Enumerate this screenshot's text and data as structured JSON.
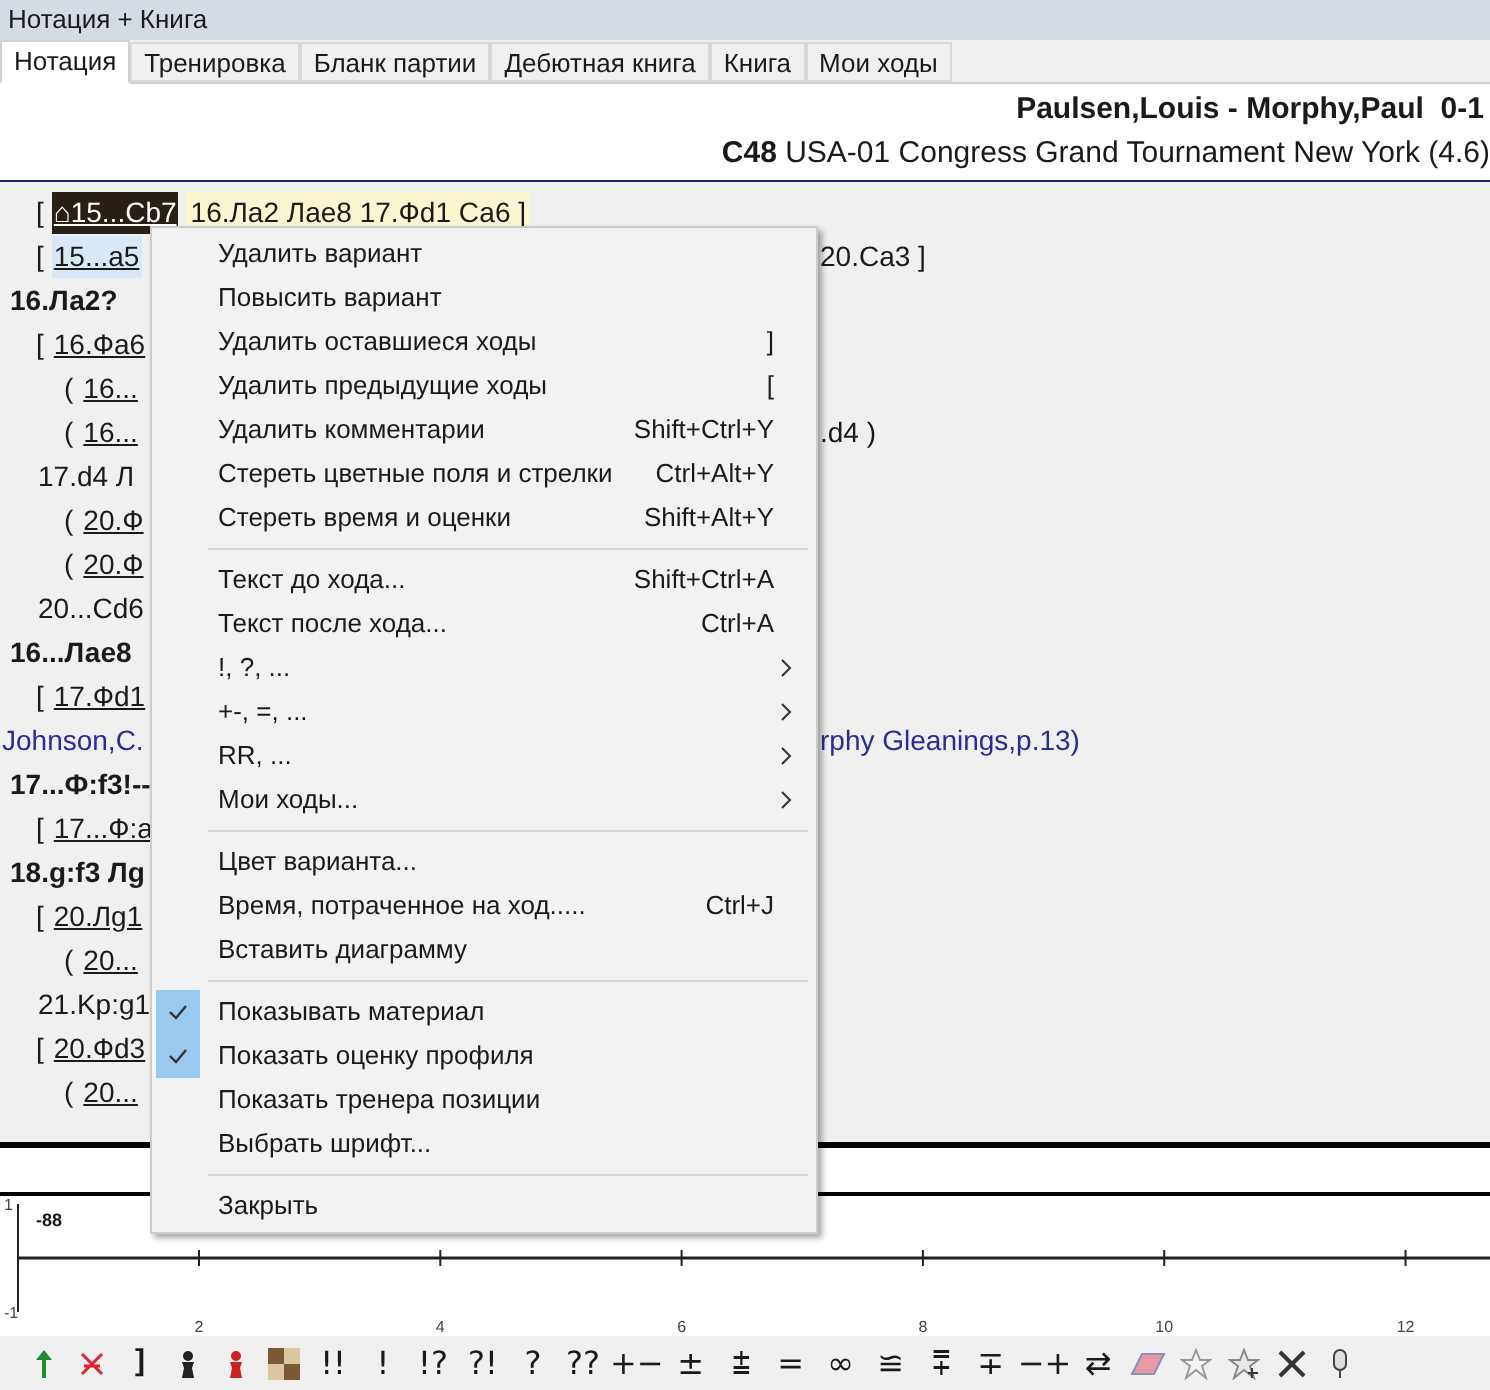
{
  "window": {
    "title": "Нотация + Книга"
  },
  "tabs": [
    {
      "label": "Нотация",
      "selected": true
    },
    {
      "label": "Тренировка",
      "selected": false
    },
    {
      "label": "Бланк партии",
      "selected": false
    },
    {
      "label": "Дебютная книга",
      "selected": false
    },
    {
      "label": "Книга",
      "selected": false
    },
    {
      "label": "Мои ходы",
      "selected": false
    }
  ],
  "game_header": {
    "players": "Paulsen,Louis - Morphy,Paul  0-1",
    "eco": "C48",
    "event": "USA-01 Congress Grand Tournament New York (4.6)"
  },
  "notation": [
    {
      "kind": "variation",
      "prefix": "[",
      "text": "⌂15...Cb7",
      "tail": "16.Ла2 Лае8 17.Фd1 Са6 ]",
      "selected": true,
      "hovered": false
    },
    {
      "kind": "variation",
      "prefix": "[",
      "text": "15...a5",
      "right": "20.Ca3 ]",
      "selected": false,
      "hovered": true
    },
    {
      "kind": "main",
      "text": "16.Ла2?",
      "selected": false,
      "hovered": false
    },
    {
      "kind": "variation",
      "prefix": "[",
      "text": "16.Фа6",
      "selected": false,
      "hovered": false
    },
    {
      "kind": "subvariation",
      "prefix": "(",
      "text": "16...",
      "selected": false,
      "hovered": false
    },
    {
      "kind": "subvariation",
      "prefix": "(",
      "text": "16...",
      "right": ".d4 )",
      "selected": false,
      "hovered": false
    },
    {
      "kind": "continuation",
      "text": "17.d4  Л",
      "selected": false,
      "hovered": false
    },
    {
      "kind": "subvariation",
      "prefix": "(",
      "text": "20.Ф",
      "selected": false,
      "hovered": false
    },
    {
      "kind": "subvariation",
      "prefix": "(",
      "text": "20.Ф",
      "selected": false,
      "hovered": false
    },
    {
      "kind": "continuation",
      "text": "20...Cd6",
      "selected": false,
      "hovered": false
    },
    {
      "kind": "main",
      "text": "16...Лае8",
      "selected": false,
      "hovered": false
    },
    {
      "kind": "variation",
      "prefix": "[",
      "text": "17.Фd1",
      "selected": false,
      "hovered": false
    },
    {
      "kind": "comment",
      "text": "Johnson,C.",
      "right": "rphy Gleanings,p.13)",
      "selected": false,
      "hovered": false
    },
    {
      "kind": "main",
      "text": "17...Ф:f3!--",
      "selected": false,
      "hovered": false
    },
    {
      "kind": "variation",
      "prefix": "[",
      "text": "17...Ф:а",
      "selected": false,
      "hovered": false
    },
    {
      "kind": "main",
      "text": "18.g:f3  Лg",
      "selected": false,
      "hovered": false
    },
    {
      "kind": "variation",
      "prefix": "[",
      "text": "20.Лg1",
      "selected": false,
      "hovered": false
    },
    {
      "kind": "subvariation",
      "prefix": "(",
      "text": "20...",
      "selected": false,
      "hovered": false
    },
    {
      "kind": "continuation",
      "text": "21.Kp:g1",
      "selected": false,
      "hovered": false
    },
    {
      "kind": "variation",
      "prefix": "[",
      "text": "20.Фd3",
      "selected": false,
      "hovered": false
    },
    {
      "kind": "subvariation",
      "prefix": "(",
      "text": "20...",
      "selected": false,
      "hovered": false
    }
  ],
  "context_menu": [
    {
      "kind": "item",
      "label": "Удалить вариант",
      "checked": false
    },
    {
      "kind": "item",
      "label": "Повысить вариант",
      "checked": false
    },
    {
      "kind": "item",
      "label": "Удалить оставшиеся ходы",
      "shortcut": "]",
      "checked": false
    },
    {
      "kind": "item",
      "label": "Удалить предыдущие ходы",
      "shortcut": "[",
      "checked": false
    },
    {
      "kind": "item",
      "label": "Удалить комментарии",
      "shortcut": "Shift+Ctrl+Y",
      "checked": false
    },
    {
      "kind": "item",
      "label": "Стереть цветные поля и стрелки",
      "shortcut": "Ctrl+Alt+Y",
      "checked": false
    },
    {
      "kind": "item",
      "label": "Стереть время и оценки",
      "shortcut": "Shift+Alt+Y",
      "checked": false
    },
    {
      "kind": "separator"
    },
    {
      "kind": "item",
      "label": "Текст до хода...",
      "shortcut": "Shift+Ctrl+A",
      "checked": false
    },
    {
      "kind": "item",
      "label": "Текст после хода...",
      "shortcut": "Ctrl+A",
      "checked": false
    },
    {
      "kind": "submenu",
      "label": "!, ?, ...",
      "checked": false
    },
    {
      "kind": "submenu",
      "label": "+-, =, ...",
      "checked": false
    },
    {
      "kind": "submenu",
      "label": "RR, ...",
      "checked": false
    },
    {
      "kind": "submenu",
      "label": "Мои ходы...",
      "checked": false
    },
    {
      "kind": "separator"
    },
    {
      "kind": "item",
      "label": "Цвет варианта...",
      "checked": false
    },
    {
      "kind": "item",
      "label": "Время, потраченное на ход.....",
      "shortcut": "Ctrl+J",
      "checked": false
    },
    {
      "kind": "item",
      "label": "Вставить диаграмму",
      "checked": false
    },
    {
      "kind": "separator"
    },
    {
      "kind": "item",
      "label": "Показывать материал",
      "checked": true
    },
    {
      "kind": "item",
      "label": "Показать оценку профиля",
      "checked": true
    },
    {
      "kind": "item",
      "label": "Показать тренера позиции",
      "checked": false
    },
    {
      "kind": "item",
      "label": "Выбрать шрифт...",
      "checked": false
    },
    {
      "kind": "separator"
    },
    {
      "kind": "item",
      "label": "Закрыть",
      "checked": false
    }
  ],
  "evaluation_graph": {
    "chart_data": {
      "type": "line",
      "xlim": [
        0.5,
        12.7
      ],
      "xticks": [
        2,
        4,
        6,
        8,
        10,
        12
      ],
      "yticks": [
        -1,
        1
      ],
      "ylim": [
        -1,
        1
      ],
      "annotations": [
        "-88"
      ]
    }
  },
  "toolbar": {
    "bracket": "]",
    "glyphs": [
      "!!",
      "!",
      "!?",
      "?!",
      "?",
      "??",
      "+−",
      "±",
      "⩲",
      "=",
      "∞",
      "≌",
      "⩱",
      "∓",
      "−+",
      "⇄"
    ]
  }
}
